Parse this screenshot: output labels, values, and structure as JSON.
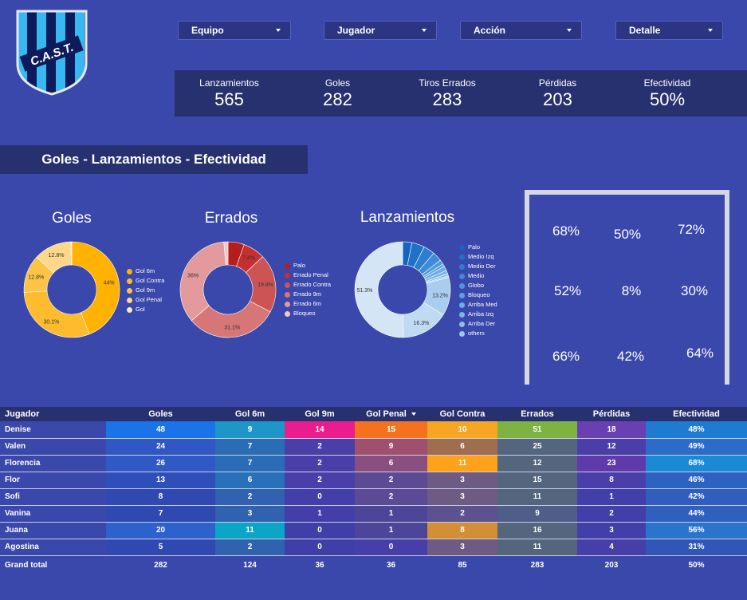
{
  "logo": {
    "text": "C.A.S.T."
  },
  "filters": [
    {
      "label": "Equipo"
    },
    {
      "label": "Jugador"
    },
    {
      "label": "Acción"
    },
    {
      "label": "Detalle"
    }
  ],
  "kpis": [
    {
      "label": "Lanzamientos",
      "value": "565"
    },
    {
      "label": "Goles",
      "value": "282"
    },
    {
      "label": "Tiros Errados",
      "value": "283"
    },
    {
      "label": "Pérdidas",
      "value": "203"
    },
    {
      "label": "Efectividad",
      "value": "50%"
    }
  ],
  "section_title": "Goles - Lanzamientos - Efectividad",
  "chart_data": [
    {
      "type": "pie",
      "title": "Goles",
      "categories": [
        "Gol 6m",
        "Gol Contra",
        "Gol 9m",
        "Gol Penal",
        "Gol"
      ],
      "values": [
        44.0,
        30.1,
        12.8,
        12.8,
        0.3
      ],
      "labels": [
        "44%",
        "30.1%",
        "12.8%",
        "12.8%",
        ""
      ],
      "colors": [
        "#ffb300",
        "#fdbb2d",
        "#fcc447",
        "#fdd78a",
        "#fbe8c0"
      ],
      "legend": "right"
    },
    {
      "type": "pie",
      "title": "Errados",
      "categories": [
        "Palo",
        "Errado Penal",
        "Errado Contra",
        "Errado 9m",
        "Errado 6m",
        "Bloqueo"
      ],
      "values": [
        5.5,
        7.4,
        19.8,
        31.1,
        34.8,
        1.4
      ],
      "labels": [
        "",
        "7.4%",
        "19.8%",
        "31.1%",
        "36%",
        ""
      ],
      "colors": [
        "#b71c1c",
        "#c62f2f",
        "#cc5454",
        "#d67676",
        "#e39a9c",
        "#f1c7c8"
      ],
      "legend": "right"
    },
    {
      "type": "pie",
      "title": "Lanzamientos",
      "categories": [
        "Palo",
        "Medio Izq",
        "Medio Der",
        "Medio",
        "Globo",
        "Bloqueo",
        "Arriba Med",
        "Arriba Izq",
        "Arriba Der",
        "others"
      ],
      "values": [
        3.2,
        4.4,
        3.9,
        3.3,
        1.5,
        1.0,
        1.5,
        1.2,
        0.8,
        0.5,
        13.2,
        16.3,
        51.3
      ],
      "labels": [
        "",
        "",
        "",
        "",
        "",
        "",
        "",
        "",
        "",
        "",
        "13.2%",
        "16.3%",
        "51.3%"
      ],
      "colors": [
        "#1565c0",
        "#1f71c8",
        "#2e7ed0",
        "#3f8bd6",
        "#4f97db",
        "#5ea2df",
        "#6dade3",
        "#7bb7e7",
        "#89c1ea",
        "#97caed",
        "#a9cdee",
        "#c0daf2",
        "#d4e5f6"
      ],
      "legend": "right"
    }
  ],
  "goal_zones": [
    "68%",
    "50%",
    "72%",
    "52%",
    "8%",
    "30%",
    "66%",
    "42%",
    "64%"
  ],
  "table": {
    "headers": [
      "Jugador",
      "Goles",
      "Gol 6m",
      "Gol 9m",
      "Gol Penal",
      "Gol Contra",
      "Errados",
      "Pérdidas",
      "Efectividad"
    ],
    "sort_icon": "sort-down-icon",
    "rows": [
      [
        "Denise",
        "48",
        "9",
        "14",
        "15",
        "10",
        "51",
        "18",
        "48%"
      ],
      [
        "Valen",
        "24",
        "7",
        "2",
        "9",
        "6",
        "25",
        "12",
        "49%"
      ],
      [
        "Florencia",
        "26",
        "7",
        "2",
        "6",
        "11",
        "12",
        "23",
        "68%"
      ],
      [
        "Flor",
        "13",
        "6",
        "2",
        "2",
        "3",
        "15",
        "8",
        "46%"
      ],
      [
        "Sofi",
        "8",
        "2",
        "0",
        "2",
        "3",
        "11",
        "1",
        "42%"
      ],
      [
        "Vanina",
        "7",
        "3",
        "1",
        "1",
        "2",
        "9",
        "2",
        "44%"
      ],
      [
        "Juana",
        "20",
        "11",
        "0",
        "1",
        "8",
        "16",
        "3",
        "56%"
      ],
      [
        "Agostina",
        "5",
        "2",
        "0",
        "0",
        "3",
        "11",
        "4",
        "31%"
      ]
    ],
    "total": [
      "Grand total",
      "282",
      "124",
      "36",
      "36",
      "85",
      "283",
      "203",
      "50%"
    ],
    "cell_colors": [
      [
        "#3a47ab",
        "#1a73e8",
        "#1e96c8",
        "#e91e8c",
        "#f4721e",
        "#f5a623",
        "#7cb342",
        "#6a3fb0",
        "#1e7bd0"
      ],
      [
        "#3a47ab",
        "#3157c4",
        "#2a6cb5",
        "#4a3fa8",
        "#a0506e",
        "#a06e4e",
        "#54657e",
        "#4a3fa8",
        "#2a6cc8"
      ],
      [
        "#3a47ab",
        "#2f5ac5",
        "#2a6cb5",
        "#4a3fa8",
        "#8a4e7f",
        "#ffa21a",
        "#54657e",
        "#5e3aaa",
        "#1a8ad4"
      ],
      [
        "#3a47ab",
        "#2f4fb8",
        "#2870b8",
        "#4a3fa8",
        "#5d4a94",
        "#6d5b83",
        "#54657e",
        "#4a3fa8",
        "#2e62c0"
      ],
      [
        "#3a47ab",
        "#3049b0",
        "#3062b0",
        "#443fa8",
        "#5d4a94",
        "#6d5b83",
        "#54657e",
        "#423fa8",
        "#2f5ebd"
      ],
      [
        "#3a47ab",
        "#3049b0",
        "#3062b0",
        "#443fa8",
        "#4d4598",
        "#5d5290",
        "#4e5e88",
        "#423fa8",
        "#2f60be"
      ],
      [
        "#3a47ab",
        "#2d62cc",
        "#0ba6c6",
        "#403fa8",
        "#4d4598",
        "#d38f36",
        "#54657e",
        "#423fa8",
        "#2a74cc"
      ],
      [
        "#3a47ab",
        "#3049b0",
        "#3062b0",
        "#403fa8",
        "#463fa8",
        "#6d5b83",
        "#54657e",
        "#463fa8",
        "#3056b8"
      ]
    ]
  }
}
